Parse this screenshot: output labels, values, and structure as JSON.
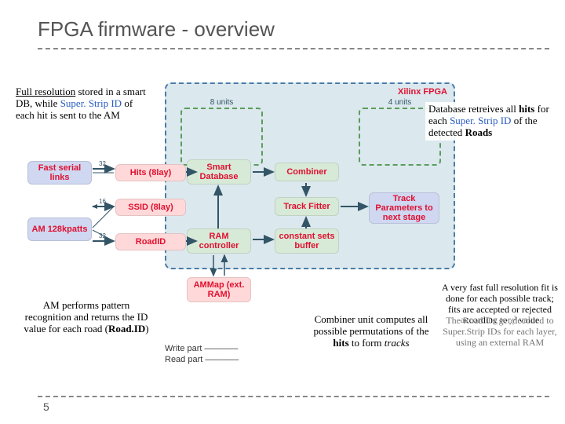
{
  "title": "FPGA firmware - overview",
  "pagenum": "5",
  "region_title": "Xilinx FPGA",
  "unit_labels": {
    "left": "8 units",
    "right": "4 units"
  },
  "nodes": {
    "fastlinks": "Fast serial\nlinks",
    "am": "AM\n128kpatts",
    "hits": "Hits (8lay)",
    "ssid": "SSID (8lay)",
    "roadid": "RoadID",
    "smartdb": "Smart\nDatabase",
    "ramctrl": "RAM\ncontroller",
    "ammap": "AMMap\n(ext. RAM)",
    "combiner": "Combiner",
    "trackfit": "Track Fitter",
    "constbuf": "constant\nsets buffer",
    "trackout": "Track\nParameters\nto next stage"
  },
  "bus": {
    "a": "32",
    "b": "16",
    "c": "32"
  },
  "write_read": {
    "w": "Write part –––––––",
    "r": "Read  part –––––––"
  },
  "notes": {
    "n1": {
      "pre": "Full resolution",
      "post": " stored in a smart DB, while ",
      "link": "Super. Strip ID",
      "tail": " of each hit is sent to the AM"
    },
    "n2": {
      "t": "AM performs pattern recognition and returns the ID value for each road (",
      "bold": "Road.ID",
      "t2": ")"
    },
    "n3": {
      "a": "Combiner unit computes all possible permutations of the ",
      "b": "hits",
      "c": " to form ",
      "d": "tracks"
    },
    "n4": {
      "a": "Database retreives all ",
      "b": "hits",
      "c": " for each ",
      "d": "Super. Strip ID",
      "e": " of the detected ",
      "f": "Roads"
    },
    "n5a": "A very fast full resolution fit is done for each possible track; fits are accepted or rejected according to χ² value",
    "n5b": "The RoadIDs get decoded to Super.Strip IDs for each layer, using an external RAM"
  }
}
